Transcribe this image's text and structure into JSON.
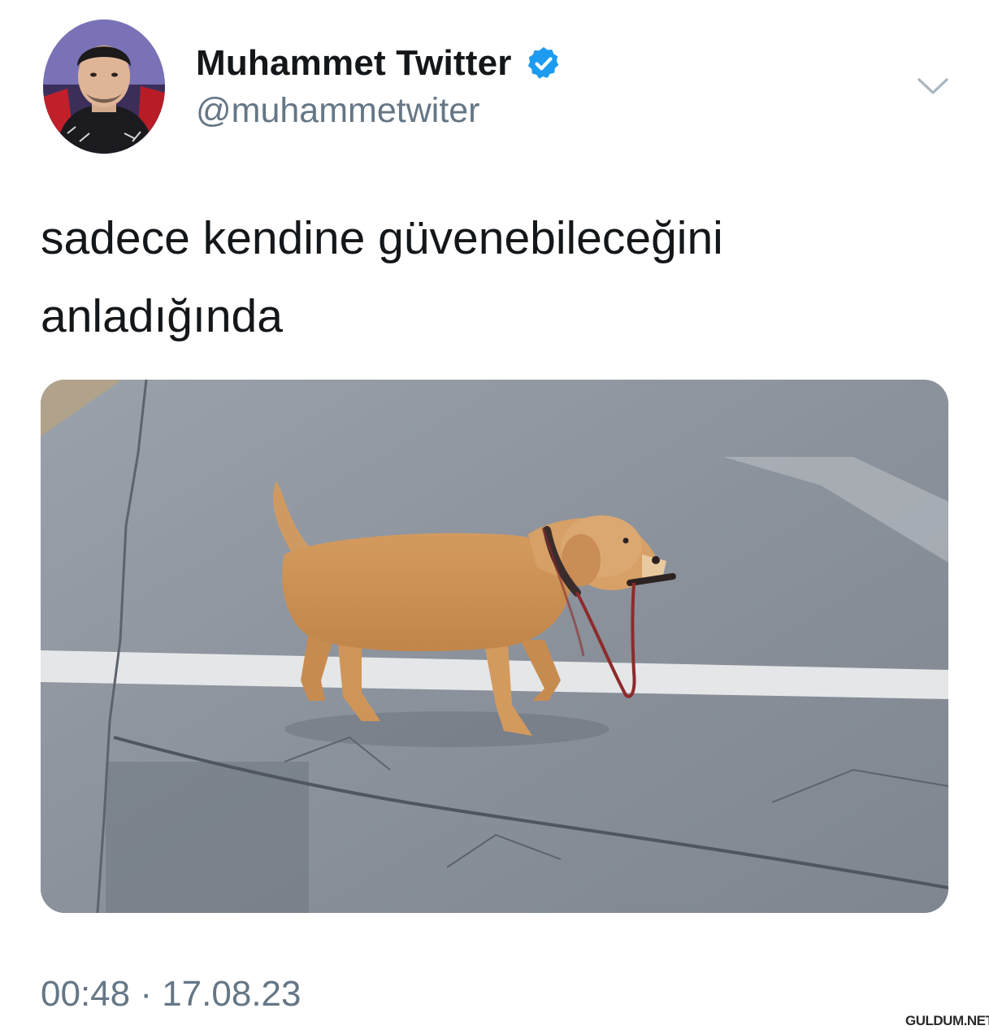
{
  "tweet": {
    "author": {
      "display_name": "Muhammet Twitter",
      "handle": "@muhammetwiter",
      "verified": true,
      "avatar_icon": "profile-photo"
    },
    "menu_icon": "chevron-down-icon",
    "text": "sadece kendine güvenebileceğini\nanladığında",
    "media": {
      "description_icon": "photo-dog-carrying-leash"
    },
    "timestamp": "00:48 · 17.08.23"
  },
  "watermark": {
    "text": "GULDUM.NET"
  },
  "colors": {
    "text_primary": "#14171a",
    "text_secondary": "#657786",
    "verified_blue": "#1d9bf0",
    "background": "#ffffff"
  }
}
